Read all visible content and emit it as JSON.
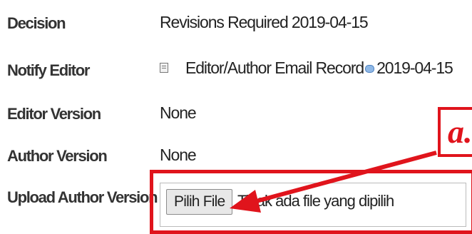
{
  "rows": [
    {
      "label": "Decision",
      "value": "Revisions Required 2019-04-15"
    },
    {
      "label": "Notify Editor",
      "link": "Editor/Author Email Record",
      "date": "2019-04-15"
    },
    {
      "label": "Editor Version",
      "value": "None"
    },
    {
      "label": "Author Version",
      "value": "None"
    },
    {
      "label": "Upload Author Version"
    }
  ],
  "file_input": {
    "button_label": "Pilih File",
    "status": "Tidak ada file yang dipilih"
  },
  "annotation": {
    "label": "a.",
    "color": "#e0141c"
  },
  "icons": {
    "notify_icon": "document-icon",
    "email_icon": "speech-bubble-icon"
  }
}
